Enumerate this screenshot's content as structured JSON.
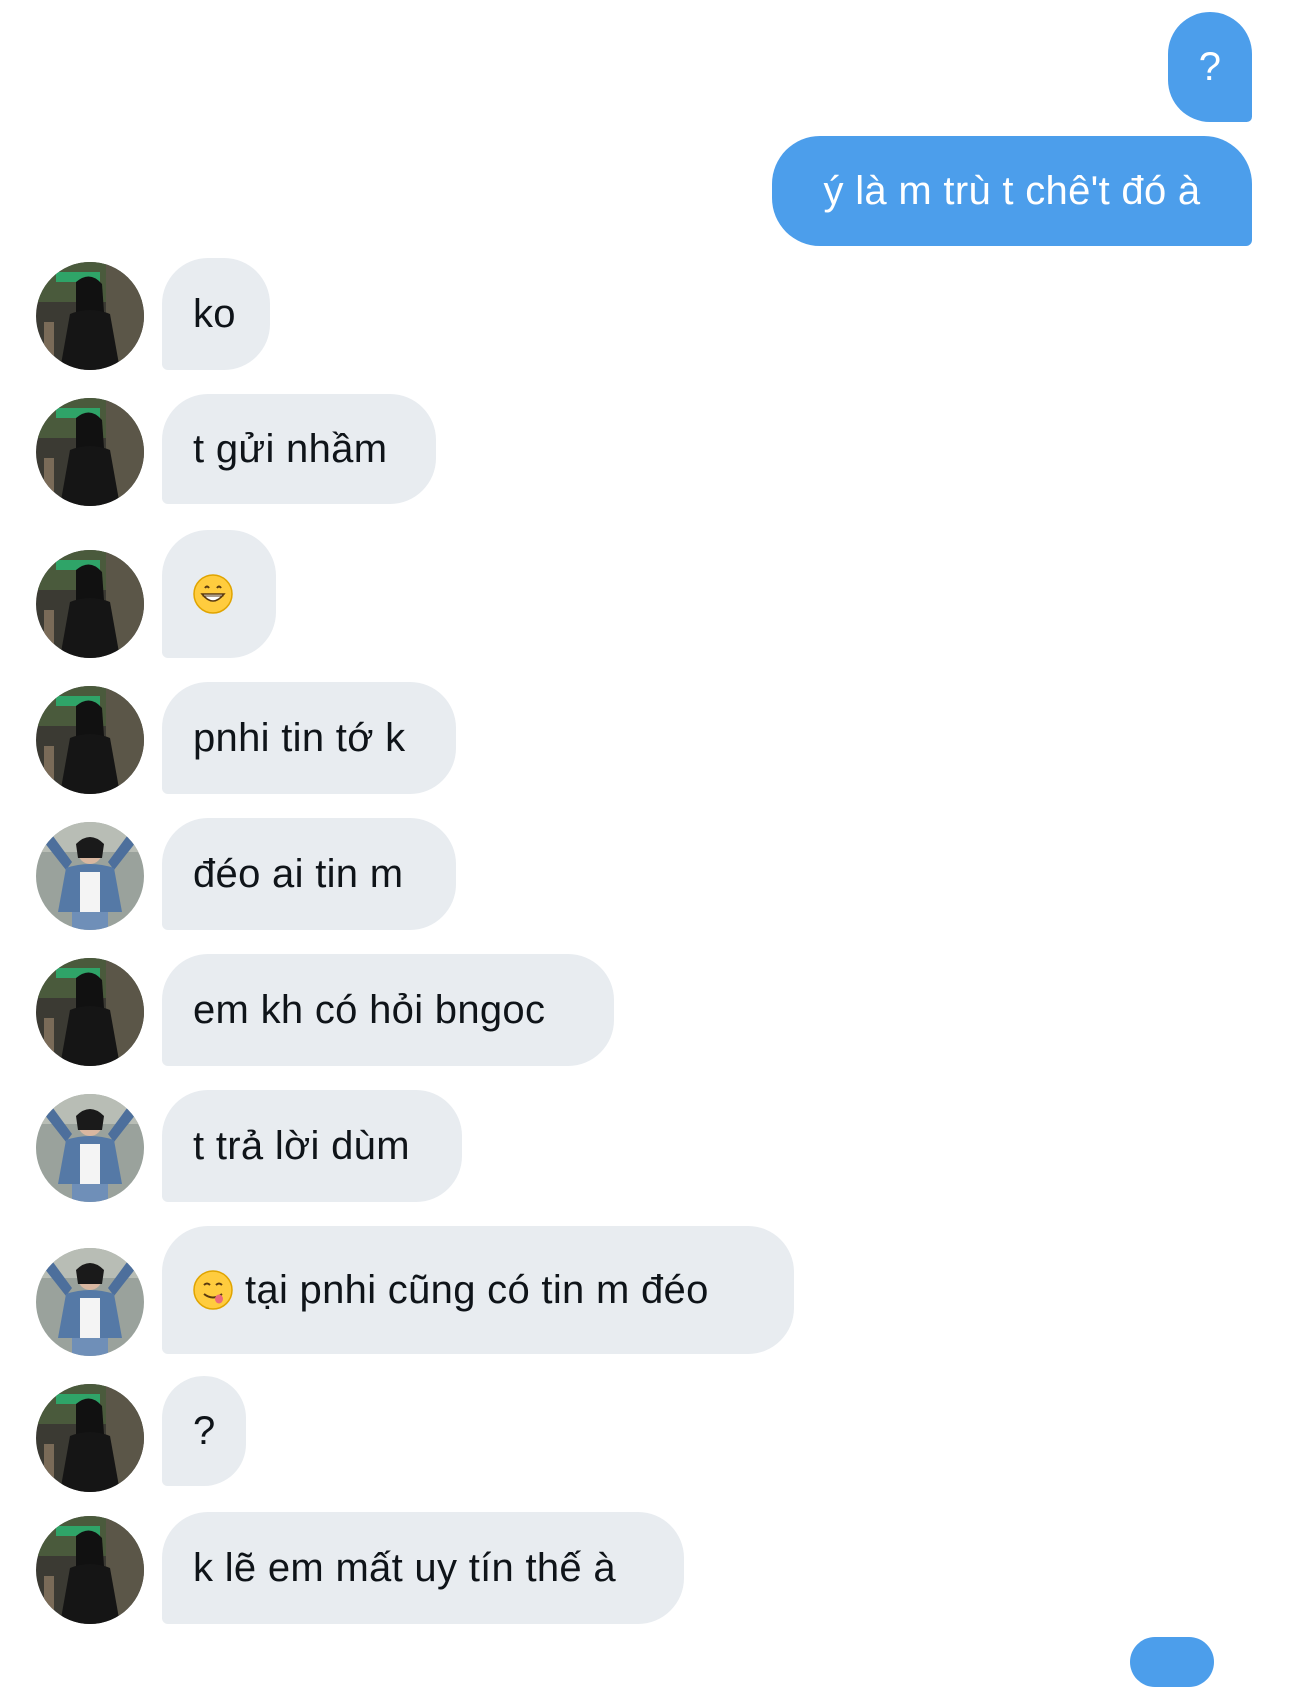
{
  "conversation": {
    "messages": [
      {
        "direction": "out",
        "text": "?"
      },
      {
        "direction": "out",
        "text": "ý là m trù t chê't đó à"
      },
      {
        "direction": "in",
        "avatar": "avatar-dark-outfit",
        "text": "ko"
      },
      {
        "direction": "in",
        "avatar": "avatar-dark-outfit",
        "text": "t gửi nhầm"
      },
      {
        "direction": "in",
        "avatar": "avatar-dark-outfit",
        "emoji": "grinning-face-emoji",
        "text": ""
      },
      {
        "direction": "in",
        "avatar": "avatar-dark-outfit",
        "text": "pnhi tin tớ k"
      },
      {
        "direction": "in",
        "avatar": "avatar-denim-jacket",
        "text": "đéo ai tin m"
      },
      {
        "direction": "in",
        "avatar": "avatar-dark-outfit",
        "text": "em kh có hỏi bngoc"
      },
      {
        "direction": "in",
        "avatar": "avatar-denim-jacket",
        "text": "t trả lời dùm"
      },
      {
        "direction": "in",
        "avatar": "avatar-denim-jacket",
        "emoji": "face-savoring-food-emoji",
        "text": "tại pnhi cũng có tin m đéo"
      },
      {
        "direction": "in",
        "avatar": "avatar-dark-outfit",
        "text": "?"
      },
      {
        "direction": "in",
        "avatar": "avatar-dark-outfit",
        "text": "k lẽ em mất uy tín thế à"
      }
    ]
  },
  "colors": {
    "outgoing_bubble": "#4c9eeb",
    "incoming_bubble": "#e8ecf0",
    "incoming_text": "#0f1419",
    "outgoing_text": "#ffffff",
    "background": "#ffffff"
  }
}
